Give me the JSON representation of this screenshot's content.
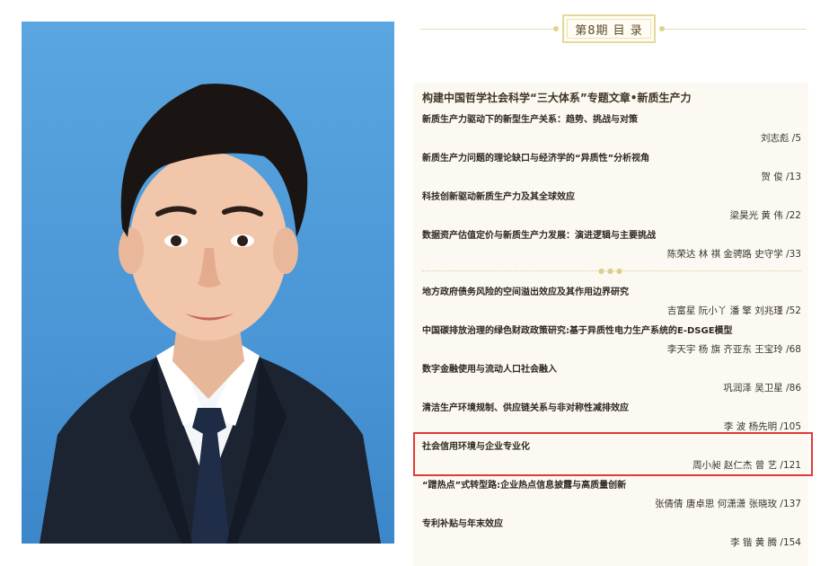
{
  "header": {
    "label": "第8期 目 录"
  },
  "section": {
    "title": "构建中国哲学社会科学“三大体系”专题文章•新质生产力"
  },
  "entries": [
    {
      "title": "新质生产力驱动下的新型生产关系：趋势、挑战与对策",
      "authors": "刘志彪 /5"
    },
    {
      "title": "新质生产力问题的理论缺口与经济学的“异质性”分析视角",
      "authors": "贺 俊 /13"
    },
    {
      "title": "科技创新驱动新质生产力及其全球效应",
      "authors": "梁昊光  黄 伟 /22"
    },
    {
      "title": "数据资产估值定价与新质生产力发展：演进逻辑与主要挑战",
      "authors": "陈荣达  林 祺  金骋路  史守学 /33"
    },
    {
      "title": "地方政府债务风险的空间溢出效应及其作用边界研究",
      "authors": "吉富星  阮小丫  潘 擎  刘兆瑾 /52"
    },
    {
      "title": "中国碳排放治理的绿色财政政策研究:基于异质性电力生产系统的E-DSGE模型",
      "authors": "李天宇  杨 旗  齐亚东  王宝玲 /68"
    },
    {
      "title": "数字金融使用与流动人口社会融入",
      "authors": "巩润泽  吴卫星 /86"
    },
    {
      "title": "清洁生产环境规制、供应链关系与非对称性减排效应",
      "authors": "李 波  杨先明 /105"
    },
    {
      "title": "社会信用环境与企业专业化",
      "authors": "周小昶  赵仁杰  曾 艺 /121"
    },
    {
      "title": "“蹭热点”式转型路:企业热点信息披露与高质量创新",
      "authors": "张倩倩  唐卓思  何潇潇  张晓玫 /137"
    },
    {
      "title": "专利补贴与年末效应",
      "authors": "李 锴  黄 腾 /154"
    }
  ],
  "highlight": {
    "entry_index": 8,
    "color": "#e23a3a"
  },
  "colors": {
    "portrait_bg": "#4a96d6",
    "paper": "#fbf9f1",
    "accent_gold": "#e4d99d"
  }
}
